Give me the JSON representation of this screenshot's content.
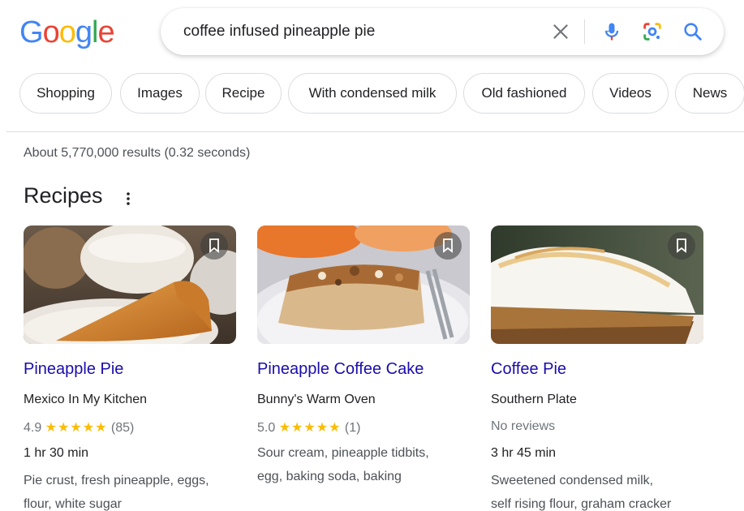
{
  "logo": {
    "letters": [
      "G",
      "o",
      "o",
      "g",
      "l",
      "e"
    ]
  },
  "search": {
    "query": "coffee infused pineapple pie"
  },
  "chips": [
    "Shopping",
    "Images",
    "Recipe",
    "With condensed milk",
    "Old fashioned",
    "Videos",
    "News"
  ],
  "results": {
    "stats": "About 5,770,000 results (0.32 seconds)"
  },
  "recipes": {
    "title": "Recipes",
    "cards": [
      {
        "title": "Pineapple Pie",
        "source": "Mexico In My Kitchen",
        "rating": "4.9",
        "stars": "★★★★★",
        "count": "(85)",
        "time": "1 hr 30 min",
        "ingredients_1": "Pie crust, fresh pineapple, eggs,",
        "ingredients_2": "flour, white sugar"
      },
      {
        "title": "Pineapple Coffee Cake",
        "source": "Bunny's Warm Oven",
        "rating": "5.0",
        "stars": "★★★★★",
        "count": "(1)",
        "ingredients_1": "Sour cream, pineapple tidbits,",
        "ingredients_2": "egg, baking soda, baking"
      },
      {
        "title": "Coffee Pie",
        "source": "Southern Plate",
        "no_reviews": "No reviews",
        "time": "3 hr 45 min",
        "ingredients_1": "Sweetened condensed milk,",
        "ingredients_2": "self rising flour, graham cracker"
      }
    ]
  },
  "colors": {
    "link": "#1a0dab",
    "star": "#fbbc04",
    "border": "#dadce0",
    "text": "#202124",
    "muted": "#4d5156"
  },
  "icons": [
    "close-icon",
    "mic-icon",
    "lens-icon",
    "search-icon",
    "more-vert-icon",
    "bookmark-icon"
  ]
}
